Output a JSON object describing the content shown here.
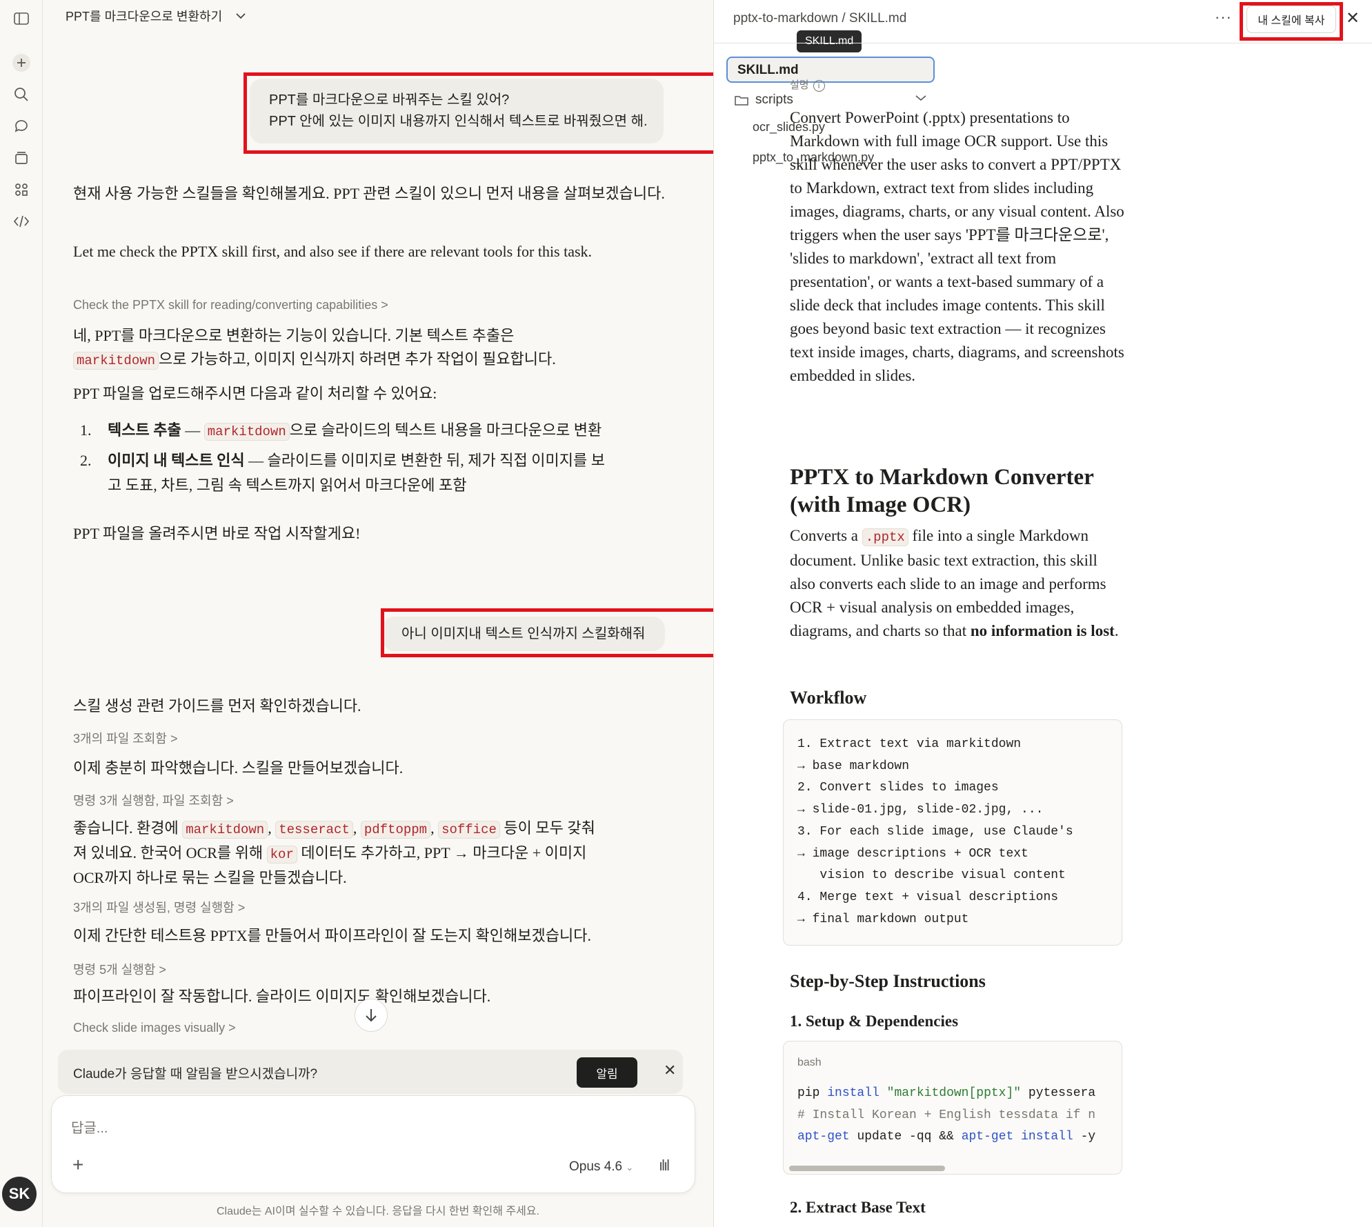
{
  "sidebar": {
    "icons": [
      "sidebar-toggle-icon",
      "new-chat-icon",
      "search-icon",
      "chats-icon",
      "projects-icon",
      "artifacts-icon",
      "code-icon"
    ],
    "avatar_initials": "SK"
  },
  "chat": {
    "title": "PPT를 마크다운으로 변환하기",
    "user_msg_1_line1": "PPT를 마크다운으로 바꿔주는 스킬 있어?",
    "user_msg_1_line2": "PPT 안에 있는 이미지 내용까지 인식해서 텍스트로 바꿔줬으면 해.",
    "assistant_1": "현재 사용 가능한 스킬들을 확인해볼게요. PPT 관련 스킬이 있으니 먼저 내용을 살펴보겠습니다.",
    "assistant_2": "Let me check the PPTX skill first, and also see if there are relevant tools for this task.",
    "step_1": "Check the PPTX skill for reading/converting capabilities",
    "assistant_3a": "네, PPT를 마크다운으로 변환하는 기능이 있습니다. 기본 텍스트 추출은",
    "assistant_3b_code": "markitdown",
    "assistant_3b_rest": "으로 가능하고, 이미지 인식까지 하려면 추가 작업이 필요합니다.",
    "assistant_4": "PPT 파일을 업로드해주시면 다음과 같이 처리할 수 있어요:",
    "list": [
      {
        "num": "1.",
        "bold": "텍스트 추출",
        "dash": " — ",
        "code": "markitdown",
        "rest": "으로 슬라이드의 텍스트 내용을 마크다운으로 변환"
      },
      {
        "num": "2.",
        "bold": "이미지 내 텍스트 인식",
        "dash": " — ",
        "rest1": "슬라이드를 이미지로 변환한 뒤, 제가 직접 이미지를 보",
        "rest2": "고 도표, 차트, 그림 속 텍스트까지 읽어서 마크다운에 포함"
      }
    ],
    "assistant_5": "PPT 파일을 올려주시면 바로 작업 시작할게요!",
    "user_msg_2": "아니 이미지내 텍스트 인식까지 스킬화해줘",
    "assistant_6": "스킬 생성 관련 가이드를 먼저 확인하겠습니다.",
    "step_2": "3개의 파일 조회함",
    "assistant_7": "이제 충분히 파악했습니다. 스킬을 만들어보겠습니다.",
    "step_3": "명령 3개 실행함, 파일 조회함",
    "assistant_8_pre": "좋습니다. 환경에",
    "tools": [
      "markitdown",
      "tesseract",
      "pdftoppm",
      "soffice"
    ],
    "sep": ",",
    "assistant_8_post1": "등이 모두 갖춰",
    "assistant_8_line2_pre": "져 있네요. 한국어 OCR를 위해",
    "kor_code": "kor",
    "assistant_8_line2_post": "데이터도 추가하고, PPT → 마크다운 + 이미지",
    "assistant_8_line3": "OCR까지 하나로 묶는 스킬을 만들겠습니다.",
    "step_4": "3개의 파일 생성됨, 명령 실행함",
    "assistant_9": "이제 간단한 테스트용 PPTX를 만들어서 파이프라인이 잘 도는지 확인해보겠습니다.",
    "step_5": "명령 5개 실행함",
    "assistant_10": "파이프라인이 잘 작동합니다. 슬라이드 이미지도 확인해보겠습니다.",
    "step_6": "Check slide images visually",
    "chevron": ">",
    "notice_text": "Claude가 응답할 때 알림을 받으시겠습니까?",
    "notice_button": "알림",
    "composer_placeholder": "답글...",
    "model": "Opus 4.6",
    "disclaimer": "Claude는 AI이며 실수할 수 있습니다. 응답을 다시 한번 확인해 주세요."
  },
  "panel": {
    "breadcrumb": "pptx-to-markdown / SKILL.md",
    "tooltip": "SKILL.md",
    "copy_button": "내 스킬에 복사",
    "files": {
      "active": "SKILL.md",
      "folder": "scripts",
      "children": [
        "ocr_slides.py",
        "pptx_to_markdown.py"
      ]
    },
    "desc_label": "설명",
    "description": "Convert PowerPoint (.pptx) presentations to Markdown with full image OCR support. Use this skill whenever the user asks to convert a PPT/PPTX to Markdown, extract text from slides including images, diagrams, charts, or any visual content. Also triggers when the user says 'PPT를 마크다운으로', 'slides to markdown', 'extract all text from presentation', or wants a text-based summary of a slide deck that includes image contents. This skill goes beyond basic text extraction — it recognizes text inside images, charts, diagrams, and screenshots embedded in slides.",
    "h1": "PPTX to Markdown Converter (with Image OCR)",
    "intro_pre": "Converts a",
    "intro_code": ".pptx",
    "intro_post": "file into a single Markdown document. Unlike basic text extraction, this skill also converts each slide to an image and performs OCR + visual analysis on embedded images, diagrams, and charts so that",
    "intro_bold": "no information is lost",
    "intro_end": ".",
    "workflow_title": "Workflow",
    "workflow_lines": [
      "1. Extract text via markitdown",
      "→ base markdown",
      "2. Convert slides to images",
      "→ slide-01.jpg, slide-02.jpg, ...",
      "3. For each slide image, use Claude's",
      "→ image descriptions + OCR text",
      "   vision to describe visual content",
      "4. Merge text + visual descriptions",
      "→ final markdown output"
    ],
    "steps_title": "Step-by-Step Instructions",
    "setup_title": "1. Setup & Dependencies",
    "bash_label": "bash",
    "bash": {
      "l1_cmd": "pip",
      "l1_kw": "install",
      "l1_str": "\"markitdown[pptx]\"",
      "l1_rest": "pytessera",
      "l2": "# Install Korean + English tessdata if n",
      "l3_a": "apt-get",
      "l3_b": "update -qq &&",
      "l3_c": "apt-get",
      "l3_d": "install",
      "l3_e": "-y"
    },
    "extract_title": "2. Extract Base Text"
  }
}
